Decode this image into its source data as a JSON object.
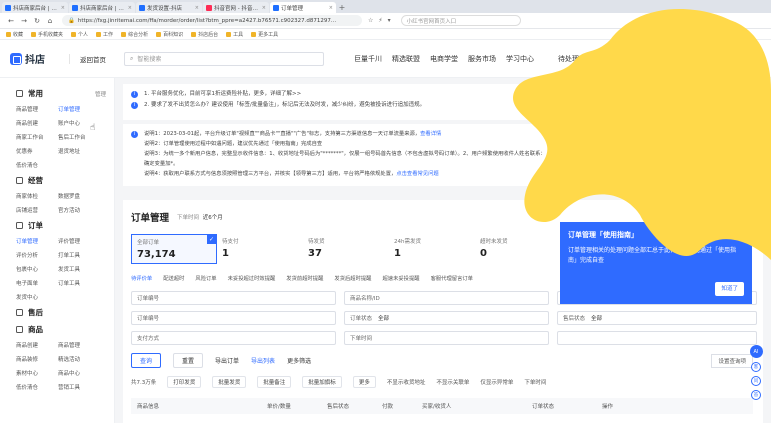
{
  "browser": {
    "tabs": [
      {
        "label": "抖店商家后台 | 抖音电商",
        "color": "#1f6fff",
        "active": false
      },
      {
        "label": "抖店商家后台 | 抖音电商",
        "color": "#1f6fff",
        "active": false
      },
      {
        "label": "发货设置-抖店",
        "color": "#1f6fff",
        "active": false
      },
      {
        "label": "抖音官网 - 抖音小店",
        "color": "#fe2c55",
        "active": false
      },
      {
        "label": "订单管理",
        "color": "#1f6fff",
        "active": true
      }
    ],
    "url": "https://fxg.jinritemai.com/ffa/morder/order/list?btm_ppre=a2427.b76571.c902327.d871297...",
    "search_placeholder": "小红书官网首页入口",
    "bookmarks": [
      "收藏",
      "手机收藏夹",
      "个人",
      "工作",
      "综合分析",
      "百科知识",
      "抖店后台",
      "工具",
      "更多工具"
    ]
  },
  "header": {
    "logo_text": "抖店",
    "back_home": "返回首页",
    "search_placeholder": "智能搜索",
    "nav": [
      "巨量千川",
      "精选联盟",
      "电商学堂",
      "服务市场",
      "学习中心"
    ],
    "pending": "待处理事项"
  },
  "sidebar": {
    "sections": [
      {
        "title": "常用",
        "manage": "管理",
        "items": [
          {
            "label": "商品管理",
            "active": false
          },
          {
            "label": "订单管理",
            "active": true
          },
          {
            "label": "商品创建",
            "active": false
          },
          {
            "label": "账户中心",
            "active": false
          },
          {
            "label": "商家工作台",
            "active": false
          },
          {
            "label": "售后工作台",
            "active": false
          },
          {
            "label": "优惠券",
            "active": false
          },
          {
            "label": "退货地址",
            "active": false
          },
          {
            "label": "低价清仓",
            "active": false
          }
        ]
      },
      {
        "title": "经营",
        "manage": "",
        "items": [
          {
            "label": "商家体检",
            "active": false
          },
          {
            "label": "数据罗盘",
            "active": false
          },
          {
            "label": "店铺运营",
            "active": false
          },
          {
            "label": "官方活动",
            "active": false
          }
        ]
      },
      {
        "title": "订单",
        "manage": "",
        "items": [
          {
            "label": "订单管理",
            "active": true
          },
          {
            "label": "评价管理",
            "active": false
          },
          {
            "label": "评价分析",
            "active": false
          },
          {
            "label": "打单工具",
            "active": false
          },
          {
            "label": "包裹中心",
            "active": false
          },
          {
            "label": "发货工具",
            "active": false
          },
          {
            "label": "电子面单",
            "active": false
          },
          {
            "label": "订单工具",
            "active": false
          },
          {
            "label": "发货中心",
            "active": false
          }
        ]
      },
      {
        "title": "售后",
        "manage": "",
        "items": []
      },
      {
        "title": "商品",
        "manage": "",
        "items": [
          {
            "label": "商品创建",
            "active": false
          },
          {
            "label": "商品管理",
            "active": false
          },
          {
            "label": "商品装修",
            "active": false
          },
          {
            "label": "精选活动",
            "active": false
          },
          {
            "label": "素材中心",
            "active": false
          },
          {
            "label": "商品中心",
            "active": false
          },
          {
            "label": "低价清仓",
            "active": false
          },
          {
            "label": "营销工具",
            "active": false
          }
        ]
      }
    ]
  },
  "notices": {
    "n1_line1": "1. 平台服务优化，目前可享1折运费险补贴，更多，详细了解>>",
    "n1_line2": "2. 要求了发不出货怎么办？建议使用「标签/批量备注」，标记后无法及时发，减少纠纷，避免被投诉进行追加违规。",
    "n2_lines": [
      {
        "text": "说明1：2023-03-01起，平台升级订单\"视频直\"\"商品卡\"\"直播\"\"广告\"标志，支持第三方渠道信息一天订单流量来源，",
        "link": "查看详情"
      },
      {
        "text": "说明2：订单管理使用过程中如遇问题，建议优先通过「使用指南」完成自查",
        "link": ""
      },
      {
        "text": "说明3：为统一多个新用户信息，完整显示收件信息：1、收货地址号码后为\"*******\"，仅展一组号码首先信息（不包含虚拟号码订单）。2、用户频繁使用收件人姓名联系：",
        "link": ""
      },
      {
        "text": "确定变量加*。",
        "link": ""
      },
      {
        "text": "说明4：获取用户联系方式与信息须按照管理三方平台，并核实【领导第三方】适用，平台将严格依规处置，",
        "link": "点击查看常见问题"
      }
    ]
  },
  "orders": {
    "title": "订单管理",
    "time_label": "下单时间",
    "time_value": "近6个月",
    "right_links": [
      "反馈建议",
      "去权益",
      "使用指南"
    ],
    "stats": [
      {
        "label": "全部订单",
        "value": "73,174",
        "active": true
      },
      {
        "label": "待支付",
        "value": "1",
        "active": false
      },
      {
        "label": "待发货",
        "value": "37",
        "active": false
      },
      {
        "label": "24h需发货",
        "value": "1",
        "active": false
      },
      {
        "label": "超时未发货",
        "value": "0",
        "active": false
      }
    ],
    "guide": {
      "title": "订单管理「使用指南」",
      "body": "订单管理相关的处理问题全部汇总于此，建议优先通过「使用指南」完成自查",
      "button": "知道了"
    },
    "subtabs": [
      "待评价单",
      "配送超时",
      "风险订单",
      "未妥投超过时效提醒",
      "发货前超时提醒",
      "发货后超时提醒",
      "超速未妥投提醒",
      "客服代理留言订单"
    ],
    "filters": [
      {
        "label": "订单编号",
        "placeholder": "",
        "value": ""
      },
      {
        "label": "商品名称/ID",
        "placeholder": "",
        "value": ""
      },
      {
        "label": "",
        "placeholder": "",
        "value": ""
      },
      {
        "label": "订单编号",
        "placeholder": "",
        "value": ""
      },
      {
        "label": "订单状态",
        "placeholder": "",
        "value": "全部"
      },
      {
        "label": "售后状态",
        "placeholder": "",
        "value": "全部"
      },
      {
        "label": "支付方式",
        "placeholder": "",
        "value": ""
      },
      {
        "label": "下单时间",
        "placeholder": "",
        "value": ""
      },
      {
        "label": "",
        "placeholder": "",
        "value": ""
      }
    ],
    "actions": {
      "query": "查询",
      "reset": "重置",
      "export": "导出订单",
      "export_list": "导出列表",
      "more_filter": "更多筛选",
      "settings": "设置查询项"
    },
    "batch": [
      "共7.3万条",
      "打印发货",
      "批量发货",
      "批量备注",
      "批量加旗标",
      "更多",
      "不显示收货地址",
      "不显示关联单",
      "仅显示异常单",
      "下单时间"
    ],
    "table_headers": [
      "商品信息",
      "单价/数量",
      "售后状态",
      "付款",
      "买家/收货人",
      "订单状态",
      "操作"
    ]
  },
  "rail": {
    "ai": "AI",
    "items": [
      "客",
      "问",
      "答"
    ]
  }
}
